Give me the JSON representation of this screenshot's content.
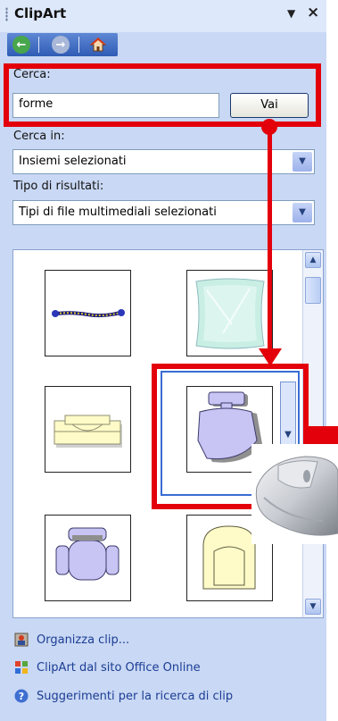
{
  "pane": {
    "title": "ClipArt",
    "dropdown_icon": "triangle-down-icon",
    "close_icon": "close-icon"
  },
  "nav": {
    "back_icon": "back-arrow-icon",
    "forward_icon": "forward-arrow-icon",
    "home_icon": "home-icon"
  },
  "search": {
    "label": "Cerca:",
    "value": "forme",
    "go_label": "Vai"
  },
  "search_in": {
    "label": "Cerca in:",
    "value": "Insiemi selezionati"
  },
  "result_type": {
    "label": "Tipo di risultati:",
    "value": "Tipi di file multimediali selezionati"
  },
  "tasks": [
    {
      "label": "Organizza clip...",
      "icon": "organize-clips-icon"
    },
    {
      "label": "ClipArt dal sito Office Online",
      "icon": "office-online-icon"
    },
    {
      "label": "Suggerimenti per la ricerca di clip",
      "icon": "help-icon"
    }
  ],
  "colors": {
    "annotation_red": "#e3000b",
    "pane_bg": "#c9d8f4",
    "clip_lavender": "#c8c4f4",
    "clip_yellow": "#fffbc8"
  }
}
